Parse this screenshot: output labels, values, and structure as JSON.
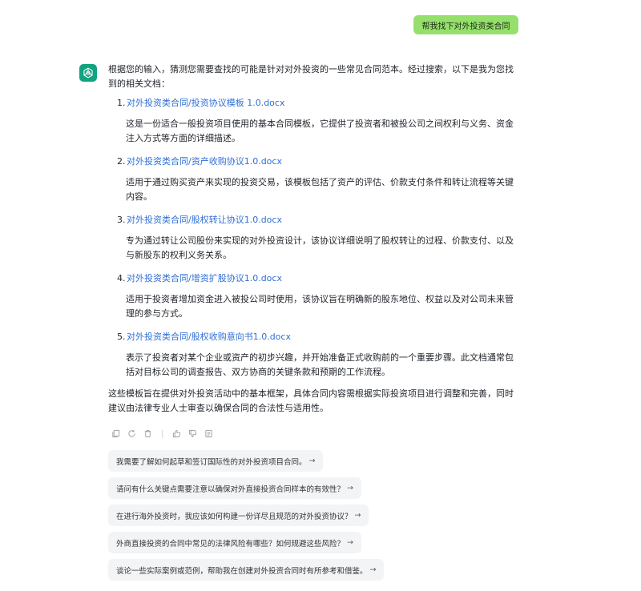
{
  "user_message": "帮我找下对外投资类合同",
  "assistant": {
    "intro": "根据您的输入，猜测您需要查找的可能是针对对外投资的一些常见合同范本。经过搜索，以下是我为您找到的相关文档：",
    "documents": [
      {
        "num": "1.",
        "title": "对外投资类合同/投资协议模板 1.0.docx",
        "desc": "这是一份适合一般投资项目使用的基本合同模板，它提供了投资者和被投公司之间权利与义务、资金注入方式等方面的详细描述。"
      },
      {
        "num": "2.",
        "title": "对外投资类合同/资产收购协议1.0.docx",
        "desc": "适用于通过购买资产来实现的投资交易，该模板包括了资产的评估、价款支付条件和转让流程等关键内容。"
      },
      {
        "num": "3.",
        "title": "对外投资类合同/股权转让协议1.0.docx",
        "desc": "专为通过转让公司股份来实现的对外投资设计，该协议详细说明了股权转让的过程、价款支付、以及与新股东的权利义务关系。"
      },
      {
        "num": "4.",
        "title": "对外投资类合同/增资扩股协议1.0.docx",
        "desc": "适用于投资者增加资金进入被投公司时使用，该协议旨在明确新的股东地位、权益以及对公司未来管理的参与方式。"
      },
      {
        "num": "5.",
        "title": "对外投资类合同/股权收购意向书1.0.docx",
        "desc": "表示了投资者对某个企业或资产的初步兴趣，并开始准备正式收购前的一个重要步骤。此文档通常包括对目标公司的调查报告、双方协商的关键条款和预期的工作流程。"
      }
    ],
    "outro": "这些模板旨在提供对外投资活动中的基本框架，具体合同内容需根据实际投资项目进行调整和完善，同时建议由法律专业人士审查以确保合同的合法性与适用性。"
  },
  "action_icons": [
    "copy-icon",
    "regenerate-icon",
    "delete-icon",
    "thumbs-up-icon",
    "thumbs-down-icon",
    "note-icon"
  ],
  "suggestions": [
    "我需要了解如何起草和签订国际性的对外投资项目合同。",
    "请问有什么关键点需要注意以确保对外直接投资合同样本的有效性？",
    "在进行海外投资时，我应该如何构建一份详尽且规范的对外投资协议？",
    "外商直接投资的合同中常见的法律风险有哪些？如何规避这些风险？",
    "谈论一些实际案例或范例，帮助我在创建对外投资合同时有所参考和借鉴。"
  ],
  "suggestion_arrow": "→",
  "colors": {
    "user_bubble": "#95e06c",
    "avatar": "#10a37f",
    "link": "#2f6fd6",
    "suggestion_bg": "#f3f4f6"
  }
}
